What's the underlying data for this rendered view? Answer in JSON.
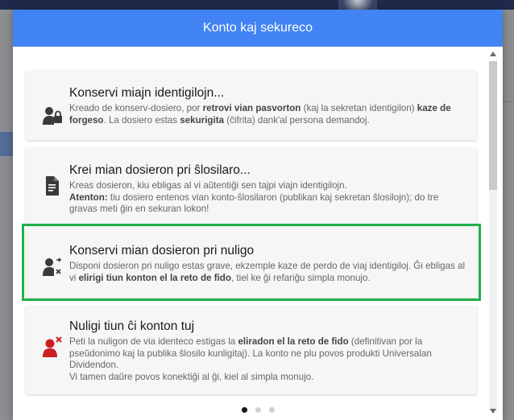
{
  "modal": {
    "title": "Konto kaj sekureco"
  },
  "cards": [
    {
      "title": "Konservi miajn identigilojn...",
      "desc": [
        {
          "text": "Kreado de konserv-dosiero, por ",
          "bold": false
        },
        {
          "text": "retrovi vian pasvorton",
          "bold": true
        },
        {
          "text": " (kaj la sekretan identigilon) ",
          "bold": false
        },
        {
          "text": "kaze de forgeso",
          "bold": true
        },
        {
          "text": ". La dosiero estas ",
          "bold": false
        },
        {
          "text": "sekurigita",
          "bold": true
        },
        {
          "text": " (ĉifrita) dank'al persona demandoj.",
          "bold": false
        }
      ],
      "icon": "user-lock-icon"
    },
    {
      "title": "Krei mian dosieron pri ŝlosilaro...",
      "desc": [
        {
          "text": "Kreas dosieron, kiu ebligas al vi aŭtentiĝi sen tajpi viajn identigilojn.",
          "bold": false,
          "br": true
        },
        {
          "text": "Atenton:",
          "bold": true
        },
        {
          "text": " tiu dosiero entenos vian konto-ŝlosilaron (publikan kaj sekretan ŝlosilojn); do tre gravas meti ĝin en sekuran lokon!",
          "bold": false
        }
      ],
      "icon": "document-key-icon"
    },
    {
      "title": "Konservi mian dosieron pri nuligo",
      "desc": [
        {
          "text": "Disponi dosieron pri nuligo estas grave, ekzemple kaze de perdo de viaj identigiloj. Ĝi ebligas al vi ",
          "bold": false
        },
        {
          "text": "elirigi tiun konton el la reto de fido",
          "bold": true
        },
        {
          "text": ", tiel ke ĝi refariĝu simpla monujo.",
          "bold": false
        }
      ],
      "icon": "user-revoke-icon"
    },
    {
      "title": "Nuligi tiun ĉi konton tuj",
      "desc": [
        {
          "text": "Peti la nuligon de via identeco estigas la ",
          "bold": false
        },
        {
          "text": "eliradon el la reto de fido",
          "bold": true
        },
        {
          "text": " (definitivan por la pseŭdonimo kaj la publika ŝlosilo kunligitaj). La konto ne plu povos produkti Universalan Dividendon.",
          "bold": false,
          "br": true
        },
        {
          "text": "Vi tamen daŭre povos konektiĝi al ĝi, kiel al simpla monujo.",
          "bold": false
        }
      ],
      "icon": "user-delete-icon"
    }
  ],
  "pager": {
    "total": 3,
    "active": 1
  },
  "colors": {
    "header": "#4283f3",
    "highlight": "#21b04a",
    "danger": "#cc1f1f",
    "icon": "#3a3a3a"
  }
}
